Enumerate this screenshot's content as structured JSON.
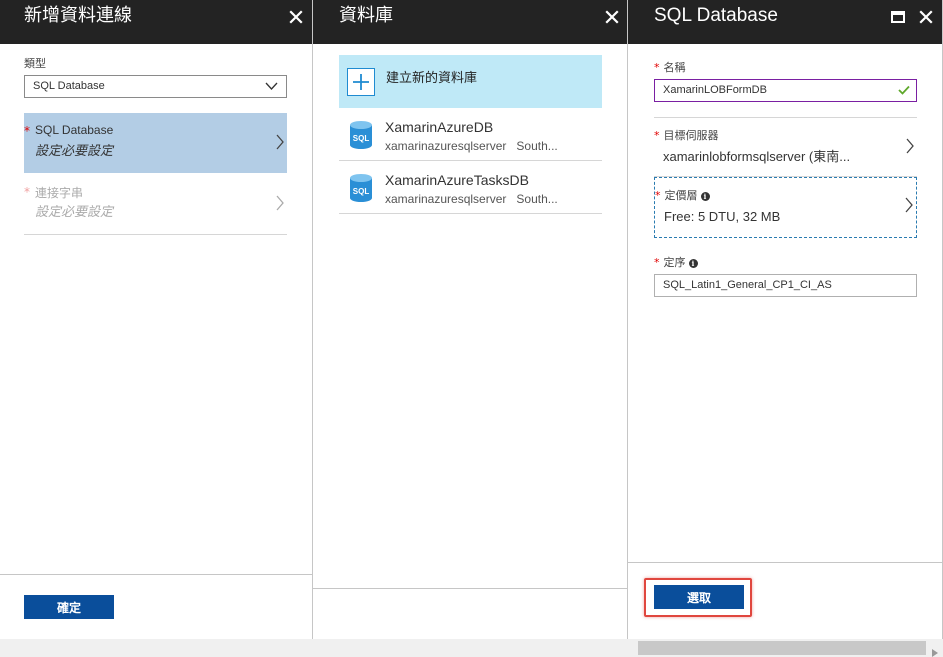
{
  "blade1": {
    "title": "新增資料連線",
    "type_label": "類型",
    "type_value": "SQL Database",
    "items": [
      {
        "label": "SQL Database",
        "status": "設定必要設定"
      },
      {
        "label": "連接字串",
        "status": "設定必要設定"
      }
    ],
    "confirm_label": "確定"
  },
  "blade2": {
    "title": "資料庫",
    "create_label": "建立新的資料庫",
    "databases": [
      {
        "name": "XamarinAzureDB",
        "server": "xamarinazuresqlserver",
        "region": "South..."
      },
      {
        "name": "XamarinAzureTasksDB",
        "server": "xamarinazuresqlserver",
        "region": "South..."
      }
    ],
    "icon_text": "SQL"
  },
  "blade3": {
    "title": "SQL Database",
    "name_label": "名稱",
    "name_value": "XamarinLOBFormDB",
    "server_label": "目標伺服器",
    "server_value": "xamarinlobformsqlserver (東南...",
    "pricing_label": "定價層",
    "pricing_value": "Free: 5 DTU, 32 MB",
    "collation_label": "定序",
    "collation_value": "SQL_Latin1_General_CP1_CI_AS",
    "select_label": "選取"
  },
  "required_mark": "*",
  "info_glyph": "i",
  "colors": {
    "header_bg": "#232323",
    "selected_item": "#b3cde5",
    "create_bg": "#bfe9f7",
    "primary_button": "#0a4e9b",
    "highlight": "#e0463e",
    "valid_check": "#5fa82b"
  }
}
